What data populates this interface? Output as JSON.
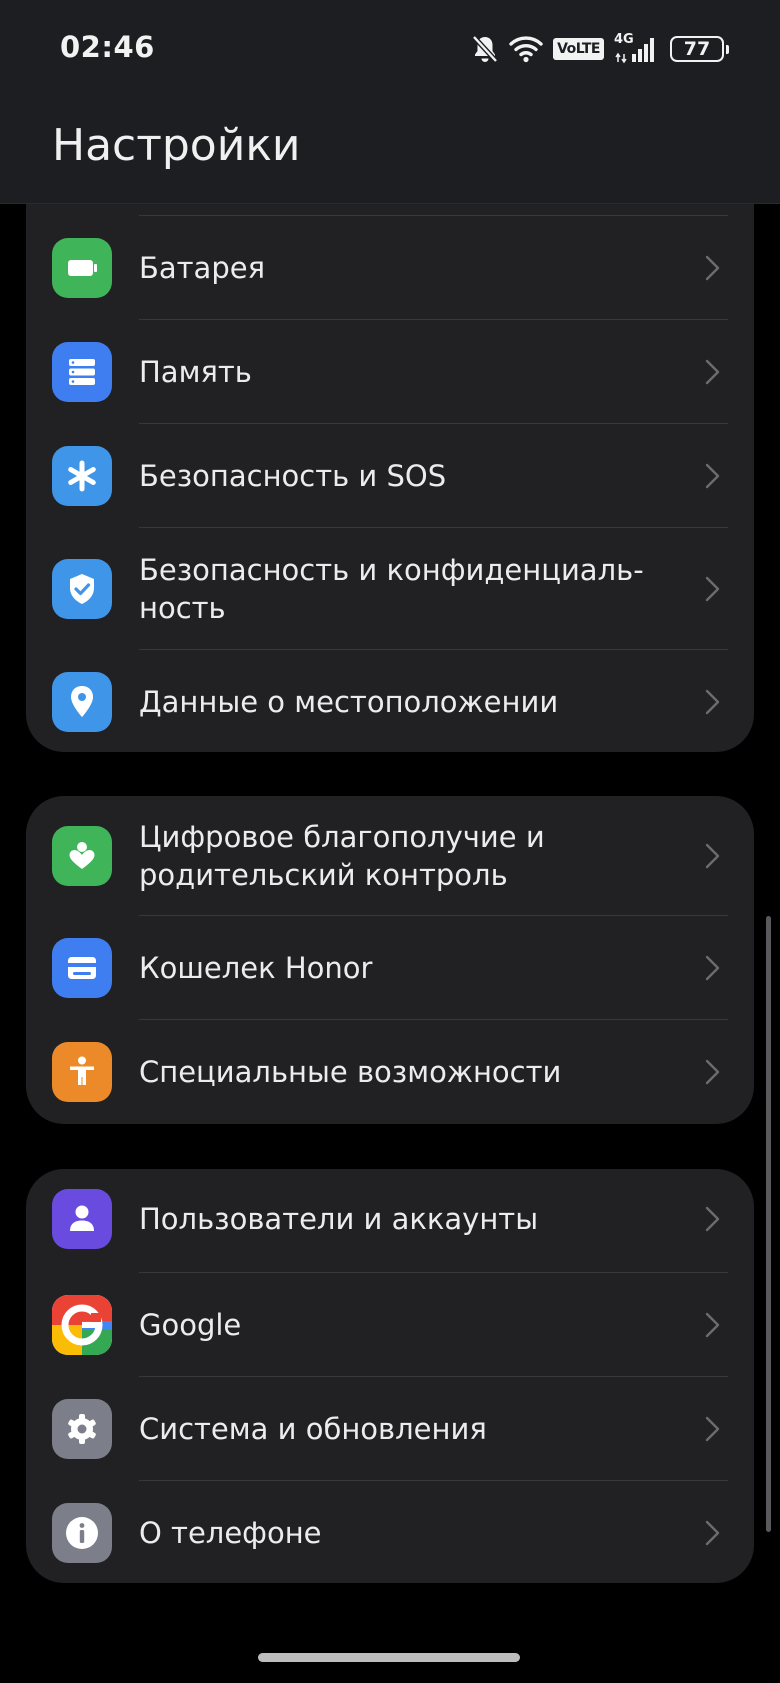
{
  "status_bar": {
    "time": "02:46",
    "volte": "VoLTE",
    "network": "4G",
    "battery": "77"
  },
  "header": {
    "title": "Настройки"
  },
  "groups": [
    {
      "items": [
        {
          "label": "Батарея",
          "icon": "battery-icon",
          "color": "#3fb458"
        },
        {
          "label": "Память",
          "icon": "storage-icon",
          "color": "#3f7ef0"
        },
        {
          "label": "Безопасность и SOS",
          "icon": "asterisk-icon",
          "color": "#3f95e8"
        },
        {
          "label": "Безопасность и конфиденциаль-ность",
          "label_line1": "Безопасность и конфиденциаль-",
          "label_line2": "ность",
          "icon": "shield-check-icon",
          "color": "#3f95e8"
        },
        {
          "label": "Данные о местоположении",
          "icon": "location-pin-icon",
          "color": "#3f95e8"
        }
      ]
    },
    {
      "items": [
        {
          "label": "Цифровое благополучие и родительский контроль",
          "label_line1": "Цифровое благополучие и",
          "label_line2": "родительский контроль",
          "icon": "digital-wellbeing-icon",
          "color": "#3fb458"
        },
        {
          "label": "Кошелек Honor",
          "icon": "wallet-icon",
          "color": "#3f7ef0"
        },
        {
          "label": "Специальные возможности",
          "icon": "accessibility-icon",
          "color": "#ec8a2a"
        }
      ]
    },
    {
      "items": [
        {
          "label": "Пользователи и аккаунты",
          "icon": "user-icon",
          "color": "#6a4be0"
        },
        {
          "label": "Google",
          "icon": "google-icon",
          "color": "#ffffff"
        },
        {
          "label": "Система и обновления",
          "icon": "gear-icon",
          "color": "#7c7e8a"
        },
        {
          "label": "О телефоне",
          "icon": "info-icon",
          "color": "#7c7e8a"
        }
      ]
    }
  ]
}
